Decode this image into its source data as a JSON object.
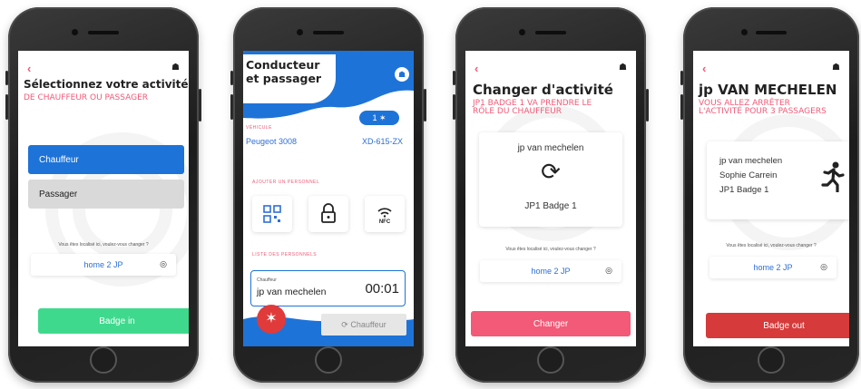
{
  "colors": {
    "blue": "#1e73d8",
    "pink": "#f25a77",
    "green": "#3fd98d",
    "red": "#d63a3a",
    "gray": "#d9d9d9"
  },
  "common": {
    "back_icon": "chevron-left-icon",
    "home_icon": "home-icon",
    "location_icon": "target-icon"
  },
  "phone1": {
    "title": "Sélectionnez votre activité",
    "subtitle": "DE CHAUFFEUR OU PASSAGER",
    "driver_button": "Chauffeur",
    "passenger_button": "Passager",
    "location_note": "Vous êtes localisé ici, voulez-vous changer ?",
    "location": "home 2 JP",
    "badge_in_button": "Badge in"
  },
  "phone2": {
    "title_line1": "Conducteur",
    "title_line2": "et passager",
    "passenger_count": "1",
    "vehicle_label": "VÉHICULE",
    "vehicle_name": "Peugeot 3008",
    "vehicle_plate": "XD-615-ZX",
    "add_staff_label": "AJOUTER UN PERSONNEL",
    "add_options": [
      "qr-code-icon",
      "lock-icon",
      "nfc-icon"
    ],
    "nfc_text": "NFC",
    "staff_list_label": "LISTE DES PERSONNELS",
    "staff": {
      "role": "Chauffeur",
      "name": "jp van mechelen",
      "time": "00:01"
    },
    "change_role_button": "Chauffeur"
  },
  "phone3": {
    "title": "Changer d'activité",
    "subtitle_line1": "JP1 BADGE 1 VA PRENDRE LE",
    "subtitle_line2": "RÔLE DU CHAUFFEUR",
    "from_person": "jp van mechelen",
    "to_person": "JP1 Badge 1",
    "location_note": "Vous êtes localisé ici, voulez-vous changer ?",
    "location": "home 2 JP",
    "change_button": "Changer"
  },
  "phone4": {
    "title": "jp VAN MECHELEN",
    "subtitle_line1": "VOUS ALLEZ ARRÊTER",
    "subtitle_line2": "L'ACTIVITÉ POUR 3 PASSAGERS",
    "people": [
      "jp van mechelen",
      "Sophie Carrein",
      "JP1 Badge 1"
    ],
    "location_note": "Vous êtes localisé ici, voulez-vous changer ?",
    "location": "home 2 JP",
    "badge_out_button": "Badge out"
  }
}
